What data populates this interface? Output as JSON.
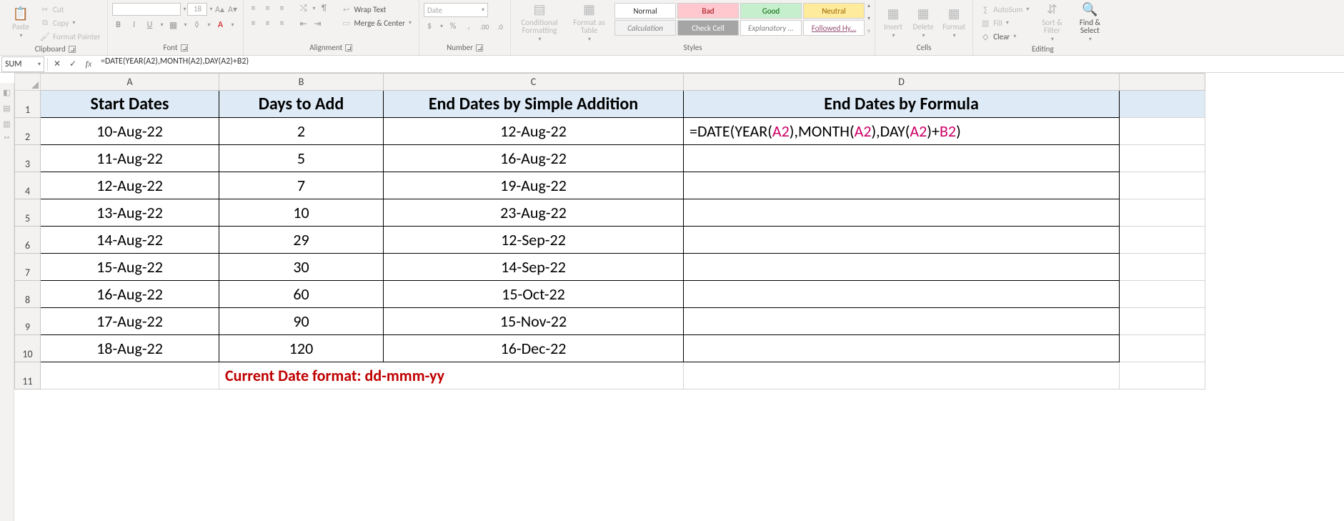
{
  "ribbon": {
    "clipboard": {
      "paste": "Paste",
      "cut": "Cut",
      "copy": "Copy",
      "format_painter": "Format Painter",
      "group_label": "Clipboard"
    },
    "font": {
      "size_value": "18",
      "group_label": "Font"
    },
    "alignment": {
      "wrap_text": "Wrap Text",
      "merge_center": "Merge & Center",
      "group_label": "Alignment"
    },
    "number": {
      "format_selected": "Date",
      "group_label": "Number"
    },
    "styles": {
      "cond_fmt": "Conditional Formatting",
      "fmt_table": "Format as Table",
      "normal": "Normal",
      "bad": "Bad",
      "good": "Good",
      "neutral": "Neutral",
      "calculation": "Calculation",
      "check_cell": "Check Cell",
      "explanatory": "Explanatory ...",
      "followed": "Followed Hy...",
      "group_label": "Styles"
    },
    "cells": {
      "insert": "Insert",
      "delete": "Delete",
      "format": "Format",
      "group_label": "Cells"
    },
    "editing": {
      "autosum": "AutoSum",
      "fill": "Fill",
      "clear": "Clear",
      "sort_filter": "Sort & Filter",
      "find_select": "Find & Select",
      "group_label": "Editing"
    }
  },
  "formula_bar": {
    "name_box": "SUM",
    "formula_text": "=DATE(YEAR(A2),MONTH(A2),DAY(A2)+B2)"
  },
  "columns": {
    "A": "A",
    "B": "B",
    "C": "C",
    "D": "D"
  },
  "headers": {
    "A": "Start Dates",
    "B": "Days to Add",
    "C": "End Dates by Simple Addition",
    "D": "End Dates by Formula"
  },
  "rows": [
    {
      "n": "2",
      "A": "10-Aug-22",
      "B": "2",
      "C": "12-Aug-22",
      "D_prefix": "=DATE(YEAR(",
      "D_r1": "A2",
      "D_m1": "),MONTH(",
      "D_r2": "A2",
      "D_m2": "),DAY(",
      "D_r3": "A2",
      "D_m3": ")+",
      "D_r4": "B2",
      "D_suffix": ")"
    },
    {
      "n": "3",
      "A": "11-Aug-22",
      "B": "5",
      "C": "16-Aug-22"
    },
    {
      "n": "4",
      "A": "12-Aug-22",
      "B": "7",
      "C": "19-Aug-22"
    },
    {
      "n": "5",
      "A": "13-Aug-22",
      "B": "10",
      "C": "23-Aug-22"
    },
    {
      "n": "6",
      "A": "14-Aug-22",
      "B": "29",
      "C": "12-Sep-22"
    },
    {
      "n": "7",
      "A": "15-Aug-22",
      "B": "30",
      "C": "14-Sep-22"
    },
    {
      "n": "8",
      "A": "16-Aug-22",
      "B": "60",
      "C": "15-Oct-22"
    },
    {
      "n": "9",
      "A": "17-Aug-22",
      "B": "90",
      "C": "15-Nov-22"
    },
    {
      "n": "10",
      "A": "18-Aug-22",
      "B": "120",
      "C": "16-Dec-22"
    }
  ],
  "footer_note": "Current Date format: dd-mmm-yy",
  "row_labels": {
    "1": "1",
    "11": "11"
  }
}
